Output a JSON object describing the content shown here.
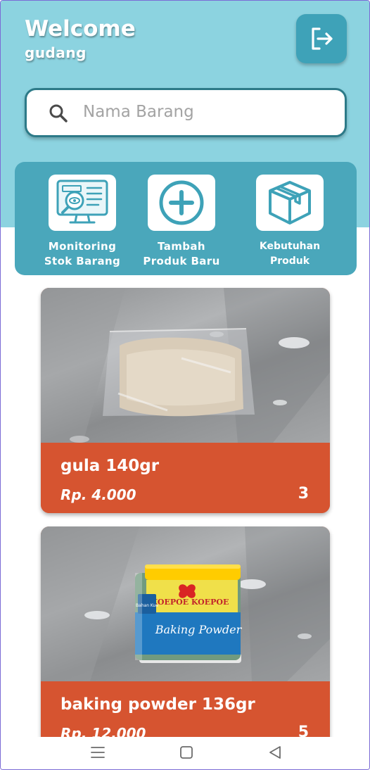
{
  "header": {
    "welcome": "Welcome",
    "username": "gudang"
  },
  "search": {
    "placeholder": "Nama Barang",
    "value": ""
  },
  "menu": [
    {
      "label": "Monitoring\nStok Barang",
      "icon": "monitor-search-icon"
    },
    {
      "label": "Tambah\nProduk Baru",
      "icon": "plus-circle-icon"
    },
    {
      "label": "Kebutuhan\nProduk",
      "icon": "box-icon"
    }
  ],
  "products": [
    {
      "name": "gula 140gr",
      "price": "Rp. 4.000",
      "qty": "3"
    },
    {
      "name": "baking powder 136gr",
      "price": "Rp. 12.000",
      "qty": "5"
    }
  ],
  "product_photo_text": {
    "brand": "KOEPOE KOEPOE",
    "product": "Baking Powder",
    "tag": "Bahan Kue"
  },
  "colors": {
    "header_bg": "#8cd3e0",
    "menu_panel": "#4aa7bb",
    "card_accent": "#d65430",
    "logout_button": "#3ea2b8"
  }
}
